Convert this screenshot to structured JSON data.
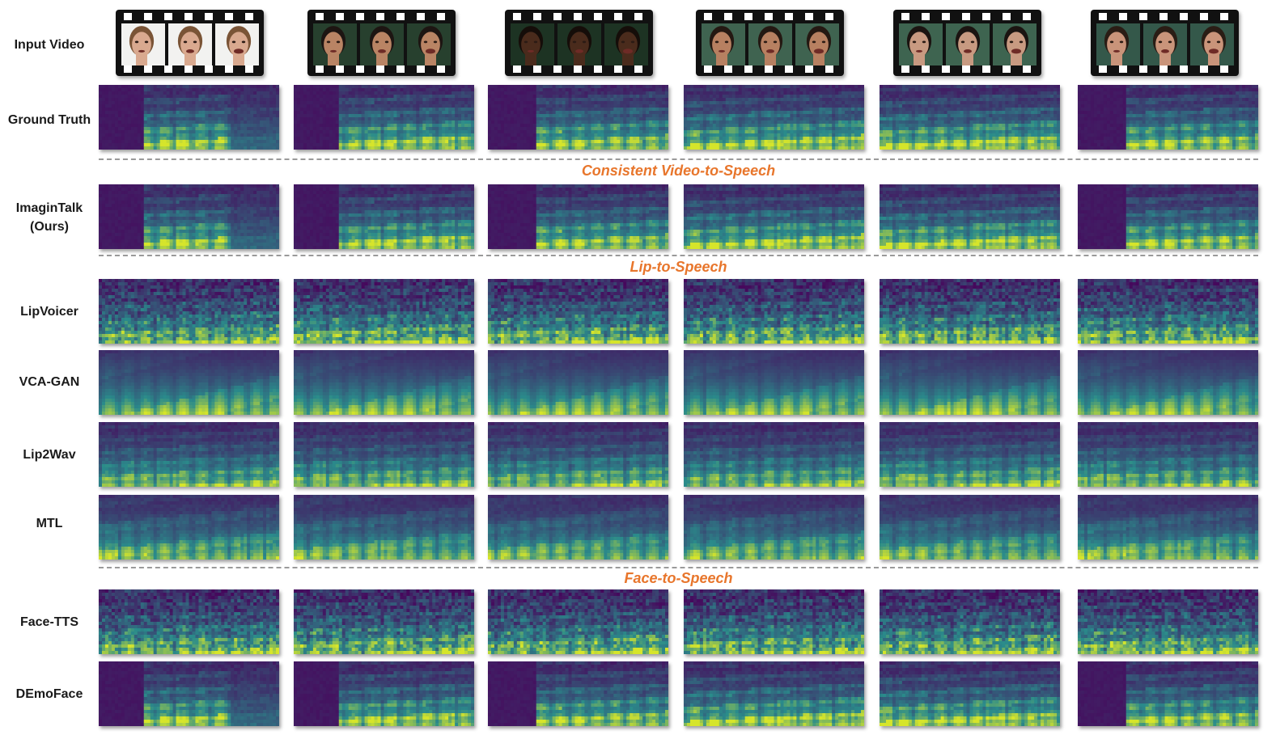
{
  "figure": {
    "rows": [
      {
        "id": "input-video",
        "label": "Input Video",
        "kind": "video"
      },
      {
        "id": "ground-truth",
        "label": "Ground Truth",
        "kind": "spec",
        "style": "gt"
      },
      {
        "id": "imagintalk",
        "label": "ImaginTalk\n(Ours)",
        "kind": "spec",
        "style": "gt"
      },
      {
        "id": "lipvoicer",
        "label": "LipVoicer",
        "kind": "spec",
        "style": "noisy"
      },
      {
        "id": "vca-gan",
        "label": "VCA-GAN",
        "kind": "spec",
        "style": "blurry"
      },
      {
        "id": "lip2wav",
        "label": "Lip2Wav",
        "kind": "spec",
        "style": "harmonic"
      },
      {
        "id": "mtl",
        "label": "MTL",
        "kind": "spec",
        "style": "smooth"
      },
      {
        "id": "face-tts",
        "label": "Face-TTS",
        "kind": "spec",
        "style": "noisy"
      },
      {
        "id": "demoface",
        "label": "DEmoFace",
        "kind": "spec",
        "style": "gt"
      }
    ],
    "sections": [
      {
        "id": "consistent-video-to-speech",
        "label": "Consistent Video-to-Speech"
      },
      {
        "id": "lip-to-speech",
        "label": "Lip-to-Speech"
      },
      {
        "id": "face-to-speech",
        "label": "Face-to-Speech"
      }
    ],
    "samples": [
      {
        "id": "s1",
        "background": "#f2f2f0",
        "skin": "#d9a98f",
        "hair": "#7a5436",
        "silence_start": 0.2
      },
      {
        "id": "s2",
        "background": "#27402e",
        "skin": "#b98464",
        "hair": "#1d1512",
        "silence_start": 0.22
      },
      {
        "id": "s3",
        "background": "#1d3323",
        "skin": "#4a2b1c",
        "hair": "#150d09",
        "silence_start": 0.2
      },
      {
        "id": "s4",
        "background": "#3f6350",
        "skin": "#b78061",
        "hair": "#241812",
        "silence_start": 0.0
      },
      {
        "id": "s5",
        "background": "#3e6450",
        "skin": "#c89a81",
        "hair": "#1b1411",
        "silence_start": 0.0
      },
      {
        "id": "s6",
        "background": "#34584a",
        "skin": "#c9947a",
        "hair": "#2a1d15",
        "silence_start": 0.2
      }
    ],
    "colors": {
      "viridis_dark": "#46085c",
      "viridis_mid": "#2a8b8b",
      "viridis_bright": "#d6e52b",
      "section_label": "#e8762c",
      "divider": "#9a9a9a"
    }
  }
}
